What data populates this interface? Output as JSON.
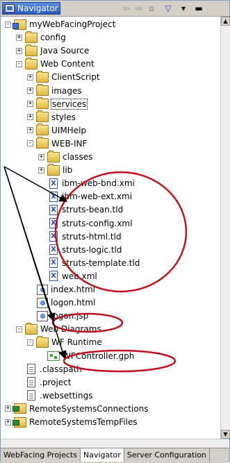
{
  "window": {
    "title": "Navigator"
  },
  "toolbar": {
    "back": "⇦",
    "forward": "⇨",
    "up": "⧈",
    "filter": "▽",
    "menu": "▾",
    "minimize": "▬"
  },
  "tree": [
    {
      "label": "myWebFacingProject",
      "depth": 0,
      "icon": "project",
      "exp": "-"
    },
    {
      "label": "config",
      "depth": 1,
      "icon": "folder",
      "exp": "+"
    },
    {
      "label": "Java Source",
      "depth": 1,
      "icon": "folder",
      "exp": "+"
    },
    {
      "label": "Web Content",
      "depth": 1,
      "icon": "folder",
      "exp": "-"
    },
    {
      "label": "ClientScript",
      "depth": 2,
      "icon": "folder",
      "exp": "+"
    },
    {
      "label": "images",
      "depth": 2,
      "icon": "folder",
      "exp": "+"
    },
    {
      "label": "services",
      "depth": 2,
      "icon": "folder",
      "exp": "+",
      "dotted": true
    },
    {
      "label": "styles",
      "depth": 2,
      "icon": "folder",
      "exp": "+"
    },
    {
      "label": "UIMHelp",
      "depth": 2,
      "icon": "folder",
      "exp": "+"
    },
    {
      "label": "WEB-INF",
      "depth": 2,
      "icon": "folder",
      "exp": "-"
    },
    {
      "label": "classes",
      "depth": 3,
      "icon": "folder",
      "exp": "+"
    },
    {
      "label": "lib",
      "depth": 3,
      "icon": "folder",
      "exp": "+"
    },
    {
      "label": "ibm-web-bnd.xmi",
      "depth": 3,
      "icon": "xfile",
      "exp": ""
    },
    {
      "label": "ibm-web-ext.xmi",
      "depth": 3,
      "icon": "xfile",
      "exp": ""
    },
    {
      "label": "struts-bean.tld",
      "depth": 3,
      "icon": "xfile",
      "exp": ""
    },
    {
      "label": "struts-config.xml",
      "depth": 3,
      "icon": "xfile",
      "exp": ""
    },
    {
      "label": "struts-html.tld",
      "depth": 3,
      "icon": "xfile",
      "exp": ""
    },
    {
      "label": "struts-logic.tld",
      "depth": 3,
      "icon": "xfile",
      "exp": ""
    },
    {
      "label": "struts-template.tld",
      "depth": 3,
      "icon": "xfile",
      "exp": ""
    },
    {
      "label": "web.xml",
      "depth": 3,
      "icon": "xfile",
      "exp": ""
    },
    {
      "label": "index.html",
      "depth": 2,
      "icon": "html",
      "exp": ""
    },
    {
      "label": "logon.html",
      "depth": 2,
      "icon": "html",
      "exp": ""
    },
    {
      "label": "logon.jsp",
      "depth": 2,
      "icon": "html",
      "exp": ""
    },
    {
      "label": "Web Diagrams",
      "depth": 1,
      "icon": "folder",
      "exp": "-"
    },
    {
      "label": "WF Runtime",
      "depth": 2,
      "icon": "folder",
      "exp": "-"
    },
    {
      "label": "WFController.gph",
      "depth": 3,
      "icon": "gph",
      "exp": ""
    },
    {
      "label": ".classpath",
      "depth": 1,
      "icon": "file",
      "exp": ""
    },
    {
      "label": ".project",
      "depth": 1,
      "icon": "file",
      "exp": ""
    },
    {
      "label": ".websettings",
      "depth": 1,
      "icon": "file",
      "exp": ""
    },
    {
      "label": "RemoteSystemsConnections",
      "depth": 0,
      "icon": "rsc",
      "exp": "+"
    },
    {
      "label": "RemoteSystemsTempFiles",
      "depth": 0,
      "icon": "rsc",
      "exp": "+"
    }
  ],
  "tabs": [
    "WebFacing Projects",
    "Navigator",
    "Server Configuration"
  ],
  "active_tab": "Navigator",
  "colors": {
    "annotation": "#c0121c",
    "arrow": "#000000"
  }
}
